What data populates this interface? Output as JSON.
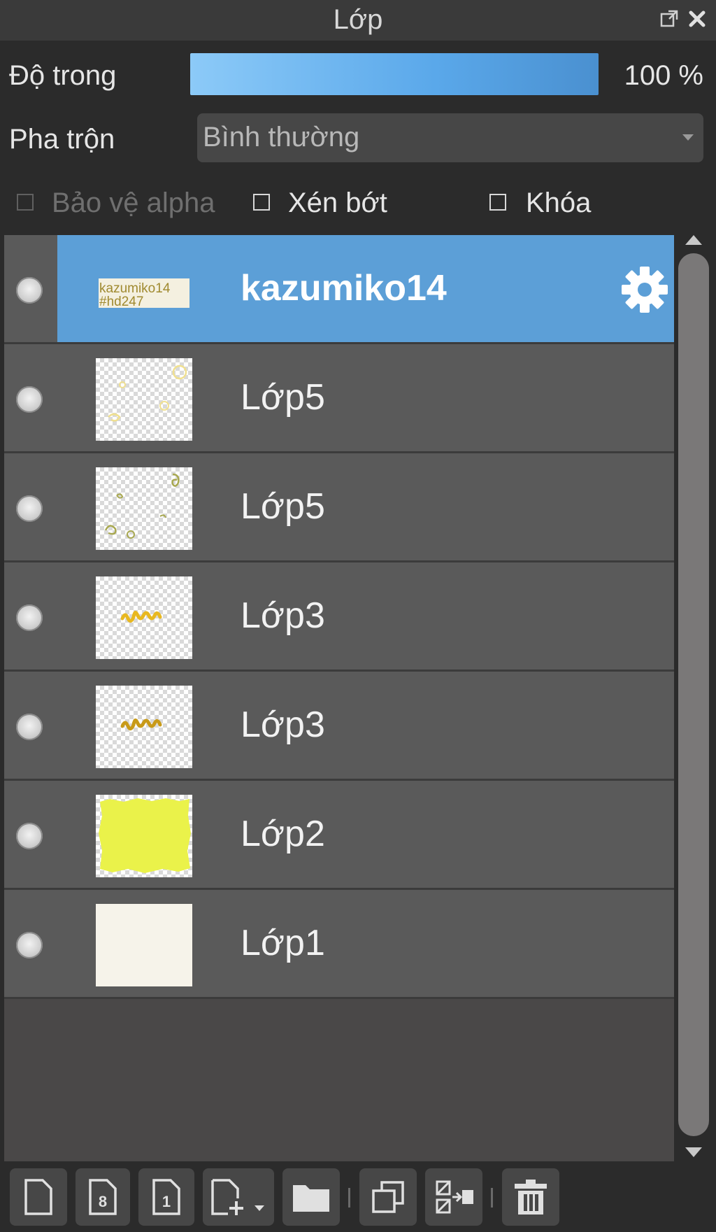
{
  "panel": {
    "title": "Lớp"
  },
  "opacity": {
    "label": "Độ trong",
    "value": "100 %",
    "level_percent": 100
  },
  "blend": {
    "label": "Pha trộn",
    "value": "Bình thường"
  },
  "options": {
    "protect_alpha": "Bảo vệ alpha",
    "clip": "Xén bớt",
    "lock": "Khóa"
  },
  "layers": [
    {
      "name": "kazumiko14",
      "selected": true,
      "thumb": "text-stamp"
    },
    {
      "name": "Lớp5",
      "selected": false,
      "thumb": "sparkles-light"
    },
    {
      "name": "Lớp5",
      "selected": false,
      "thumb": "sparkles-olive"
    },
    {
      "name": "Lớp3",
      "selected": false,
      "thumb": "script-yellow"
    },
    {
      "name": "Lớp3",
      "selected": false,
      "thumb": "script-gold"
    },
    {
      "name": "Lớp2",
      "selected": false,
      "thumb": "yellow-fill"
    },
    {
      "name": "Lớp1",
      "selected": false,
      "thumb": "empty"
    }
  ],
  "thumb_text": {
    "line1": "kazumiko14",
    "line2": "#hd247"
  },
  "toolbar": {
    "buttons": [
      "new-layer-icon",
      "new-8bit-layer-icon",
      "new-1bit-layer-icon",
      "add-layer-menu-icon",
      "new-folder-icon",
      "duplicate-layer-icon",
      "merge-down-icon",
      "delete-layer-icon"
    ]
  },
  "colors": {
    "accent": "#5c9fd7",
    "panel_bg": "#2b2b2b",
    "row_bg": "#5a5a5a",
    "yellow": "#eaf24a"
  }
}
